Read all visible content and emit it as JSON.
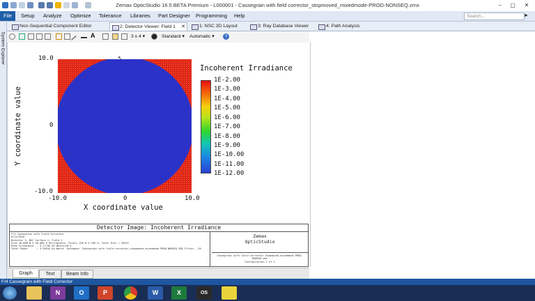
{
  "window": {
    "title": "Zemax OpticStudio 16.5  BETA  Premium  -  L000001  -  Cassegrain with field corrector_stopmoved_mixedmode-PROD-NONSEQ.zmx",
    "minimize": "–",
    "maximize": "▢",
    "close": "✕"
  },
  "menu": {
    "file": "File",
    "items": [
      "Setup",
      "Analyze",
      "Optimize",
      "Tolerance",
      "Libraries",
      "Part Designer",
      "Programming",
      "Help"
    ],
    "search_placeholder": "Search..."
  },
  "tabs": [
    {
      "label": "Non-Sequential Component Editor"
    },
    {
      "label": "2: Detector Viewer: Field 1",
      "close": "✕"
    },
    {
      "label": "1: NSC 3D Layout"
    },
    {
      "label": "3: Ray Database Viewer"
    },
    {
      "label": "4: Path Analysis"
    }
  ],
  "sidebar": {
    "label": "System Explorer"
  },
  "toolbar": {
    "grid": "3 x 4 ▾",
    "standard": "Standard ▾",
    "automatic": "Automatic ▾",
    "help": "?"
  },
  "plot": {
    "colorbar_title": "Incoherent Irradiance",
    "x_label": "X coordinate value",
    "y_label": "Y coordinate value",
    "y_ticks": [
      "10.0",
      "0",
      "-10.0"
    ],
    "x_ticks": [
      "-10.0",
      "0",
      "10.0"
    ],
    "scale_labels": [
      "1E-2.00",
      "1E-3.00",
      "1E-4.00",
      "1E-5.00",
      "1E-6.00",
      "1E-7.00",
      "1E-8.00",
      "1E-9.00",
      "1E-10.00",
      "1E-11.00",
      "1E-12.00"
    ]
  },
  "info": {
    "title": "Detector Image: Incoherent Irradiance",
    "lines": [
      "F/4 Cassegrain with Field Corrector",
      "6/14/2016",
      "Detector 3, NSC Surface 1: Field 1",
      "Size 20.000 W X 20.000 H Millimeters, Pixels 250 W X 250 H, Total Hits = 20152",
      "Peak Irradiance  : 3.1774E-03 Watts/cm^2",
      "Total Power      : 3.5051E-04 Watts  Database: Cassegrain with field corrector_stopmoved_mixedmode-PROD-NONSEQ.ZRD Filter: _10"
    ],
    "company": [
      "Zemax",
      "OpticStudio"
    ],
    "footer_lines": [
      "Cassegrain with field corrector_stopmoved_mixedmode-PROD-NONSEQ.zmx",
      "Configuration 1 of 1"
    ]
  },
  "bottom_tabs": [
    "Graph",
    "Text",
    "Beam Info"
  ],
  "status": "F/4 Cassegrain with Field Corrector",
  "taskbar": {
    "apps": [
      "explorer",
      "onenote",
      "outlook",
      "powerpoint",
      "chrome",
      "word",
      "excel",
      "opticstudio",
      "notes"
    ],
    "labels": [
      "",
      "N",
      "O",
      "P",
      "",
      "W",
      "X",
      "OS",
      ""
    ]
  },
  "colors": {
    "menu_accent": "#1f5ea7",
    "beam_blue": "#2b32c8",
    "background_red": "#e0261a"
  }
}
